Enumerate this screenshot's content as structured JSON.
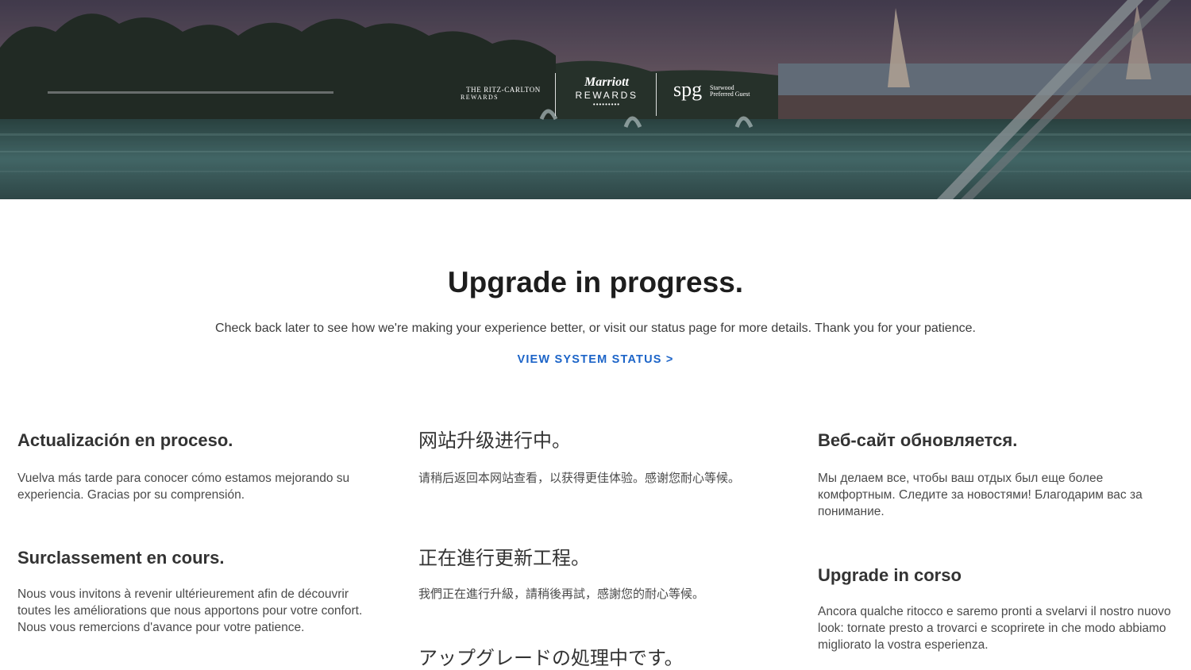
{
  "hero": {
    "logos": {
      "ritz_line1": "THE RITZ-CARLTON",
      "ritz_line2": "REWARDS",
      "marriott_line1": "Marriott",
      "marriott_line2": "REWARDS",
      "marriott_dots": "•••••••••",
      "spg_mark": "spg",
      "spg_text": "Starwood Preferred Guest"
    }
  },
  "main": {
    "title": "Upgrade in progress.",
    "subtitle": "Check back later to see how we're making your experience better, or visit our status page for more details. Thank you for your patience.",
    "status_link": "VIEW SYSTEM STATUS >"
  },
  "languages": {
    "es": {
      "title": "Actualización en proceso.",
      "body": "Vuelva más tarde para conocer cómo estamos mejorando su experiencia. Gracias por su comprensión."
    },
    "fr": {
      "title": "Surclassement en cours.",
      "body": "Nous vous invitons à revenir ultérieurement afin de découvrir toutes les améliorations que nous apportons pour votre confort. Nous vous remercions d'avance pour votre patience."
    },
    "zh_cn": {
      "title": "网站升级进行中。",
      "body": "请稍后返回本网站查看，以获得更佳体验。感谢您耐心等候。"
    },
    "zh_tw": {
      "title": "正在進行更新工程。",
      "body": "我們正在進行升級，請稍後再試，感謝您的耐心等候。"
    },
    "ja": {
      "title": "アップグレードの処理中です。"
    },
    "ru": {
      "title": "Веб-сайт обновляется.",
      "body": "Мы делаем все, чтобы ваш отдых был еще более комфортным. Следите за новостями! Благодарим вас за понимание."
    },
    "it": {
      "title": "Upgrade in corso",
      "body": "Ancora qualche ritocco e saremo pronti a svelarvi il nostro nuovo look: tornate presto a trovarci e scoprirete in che modo abbiamo migliorato la vostra esperienza."
    }
  }
}
